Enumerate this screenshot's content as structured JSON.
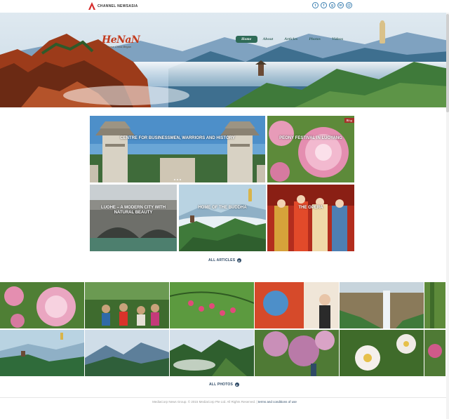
{
  "topbar": {
    "brand": "Channel NewsAsia",
    "social_icons": [
      "twitter-icon",
      "facebook-icon",
      "google-plus-icon",
      "linkedin-icon",
      "email-icon"
    ],
    "social_glyphs": [
      "t",
      "f",
      "g",
      "in",
      "@"
    ]
  },
  "hero": {
    "logo_main": "HeNaN",
    "logo_sub": "Where China Began",
    "nav": [
      {
        "label": "Home",
        "active": true
      },
      {
        "label": "About",
        "active": false
      },
      {
        "label": "Articles",
        "active": false
      },
      {
        "label": "Photos",
        "active": false
      },
      {
        "label": "Videos",
        "active": false
      }
    ]
  },
  "articles": {
    "tiles": [
      {
        "title": "CENTRE FOR BUSINESSMEN, WARRIORS AND HISTORY"
      },
      {
        "title": "PEONY FESTIVAL IN LUOYANG",
        "badge": "Blog"
      },
      {
        "title": "LUOHE – A MODERN CITY WITH NATURAL BEAUTY"
      },
      {
        "title": "HOME OF THE BUDDHA"
      },
      {
        "title": "THE OPERA"
      }
    ],
    "all_link": "ALL ARTICLES"
  },
  "photos": {
    "all_link": "ALL PHOTOS"
  },
  "footer": {
    "text": "MediaCorp News Group. © 2015 MediaCorp Pte Ltd. All Rights Reserved. |",
    "terms": "terms and conditions of use"
  },
  "colors": {
    "nav_active": "#2f6b57",
    "link": "#2e4a66",
    "logo_red": "#c33b1e",
    "badge": "#a6322a"
  }
}
